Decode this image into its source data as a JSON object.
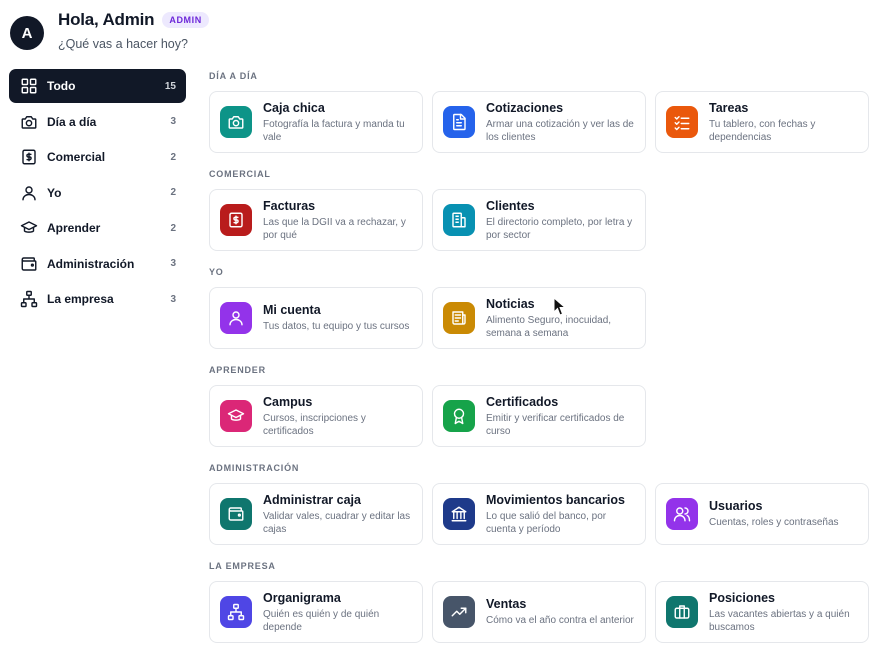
{
  "header": {
    "avatar_initial": "A",
    "greeting": "Hola, Admin",
    "role_badge": "ADMIN",
    "subtitle": "¿Qué vas a hacer hoy?"
  },
  "sidebar": {
    "items": [
      {
        "label": "Todo",
        "count": "15",
        "icon": "grid-icon",
        "active": true
      },
      {
        "label": "Día a día",
        "count": "3",
        "icon": "camera-icon"
      },
      {
        "label": "Comercial",
        "count": "2",
        "icon": "receipt-dollar-icon"
      },
      {
        "label": "Yo",
        "count": "2",
        "icon": "user-icon"
      },
      {
        "label": "Aprender",
        "count": "2",
        "icon": "graduation-cap-icon"
      },
      {
        "label": "Administración",
        "count": "3",
        "icon": "wallet-icon"
      },
      {
        "label": "La empresa",
        "count": "3",
        "icon": "org-chart-icon"
      }
    ]
  },
  "sections": [
    {
      "label": "DÍA A DÍA",
      "cards": [
        {
          "title": "Caja chica",
          "desc": "Fotografía la factura y manda tu vale",
          "icon": "camera-icon",
          "color": "#0d9488"
        },
        {
          "title": "Cotizaciones",
          "desc": "Armar una cotización y ver las de los clientes",
          "icon": "document-icon",
          "color": "#2563eb"
        },
        {
          "title": "Tareas",
          "desc": "Tu tablero, con fechas y dependencias",
          "icon": "checklist-icon",
          "color": "#ea580c"
        }
      ]
    },
    {
      "label": "COMERCIAL",
      "cards": [
        {
          "title": "Facturas",
          "desc": "Las que la DGII va a rechazar, y por qué",
          "icon": "receipt-dollar-icon",
          "color": "#b91c1c"
        },
        {
          "title": "Clientes",
          "desc": "El directorio completo, por letra y por sector",
          "icon": "building-icon",
          "color": "#0891b2"
        }
      ]
    },
    {
      "label": "YO",
      "cards": [
        {
          "title": "Mi cuenta",
          "desc": "Tus datos, tu equipo y tus cursos",
          "icon": "user-icon",
          "color": "#9333ea"
        },
        {
          "title": "Noticias",
          "desc": "Alimento Seguro, inocuidad, semana a semana",
          "icon": "newspaper-icon",
          "color": "#ca8a04"
        }
      ]
    },
    {
      "label": "APRENDER",
      "cards": [
        {
          "title": "Campus",
          "desc": "Cursos, inscripciones y certificados",
          "icon": "graduation-cap-icon",
          "color": "#db2777"
        },
        {
          "title": "Certificados",
          "desc": "Emitir y verificar certificados de curso",
          "icon": "award-icon",
          "color": "#16a34a"
        }
      ]
    },
    {
      "label": "ADMINISTRACIÓN",
      "cards": [
        {
          "title": "Administrar caja",
          "desc": "Validar vales, cuadrar y editar las cajas",
          "icon": "wallet-icon",
          "color": "#0f766e"
        },
        {
          "title": "Movimientos bancarios",
          "desc": "Lo que salió del banco, por cuenta y período",
          "icon": "bank-icon",
          "color": "#1e3a8a"
        },
        {
          "title": "Usuarios",
          "desc": "Cuentas, roles y contraseñas",
          "icon": "users-icon",
          "color": "#9333ea"
        }
      ]
    },
    {
      "label": "LA EMPRESA",
      "cards": [
        {
          "title": "Organigrama",
          "desc": "Quién es quién y de quién depende",
          "icon": "org-chart-icon",
          "color": "#4f46e5"
        },
        {
          "title": "Ventas",
          "desc": "Cómo va el año contra el anterior",
          "icon": "trend-up-icon",
          "color": "#475569"
        },
        {
          "title": "Posiciones",
          "desc": "Las vacantes abiertas y a quién buscamos",
          "icon": "briefcase-icon",
          "color": "#0f766e"
        }
      ]
    }
  ]
}
